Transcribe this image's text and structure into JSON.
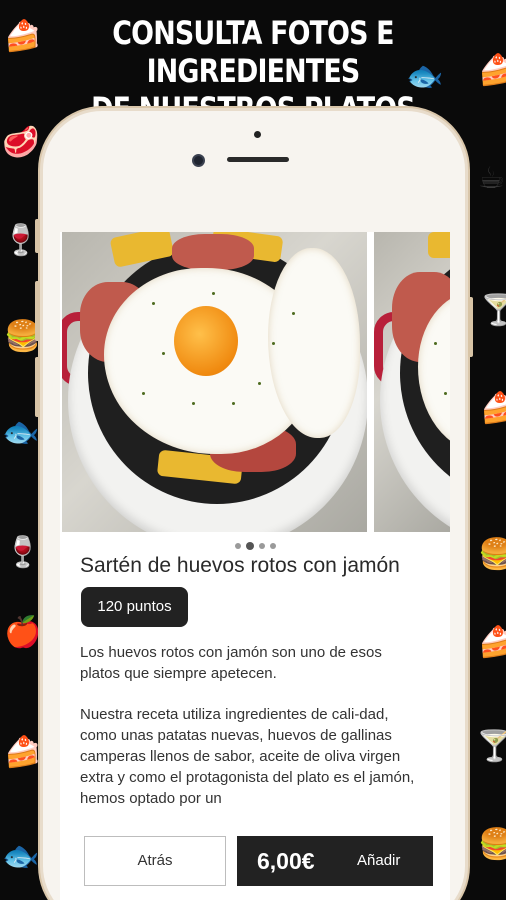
{
  "headline": {
    "line1": "CONSULTA FOTOS E INGREDIENTES",
    "line2": "DE NUESTROS PLATOS"
  },
  "product": {
    "name": "Sartén de huevos rotos con jamón",
    "points": "120 puntos",
    "description_p1": "Los huevos rotos con jamón son uno de esos platos que siempre apetecen.",
    "description_p2": "Nuestra receta utiliza ingredientes de cali-dad, como unas patatas nuevas, huevos de gallinas camperas llenos de sabor, aceite de oliva virgen extra y como el protagonista del plato es el jamón, hemos optado por un"
  },
  "carousel": {
    "total_slides": 4,
    "active_index": 1
  },
  "actions": {
    "back_label": "Atrás",
    "price": "6,00€",
    "add_label": "Añadir"
  },
  "background_icons": [
    "cake-icon",
    "fish-icon",
    "steak-icon",
    "wine-glass-icon",
    "martini-icon",
    "apple-icon",
    "burger-icon",
    "cocktail-icon",
    "cup-icon"
  ],
  "colors": {
    "background": "#0a0a0a",
    "phone_frame": "#f7f4ef",
    "dark_button": "#222222",
    "yolk": "#f08a10",
    "pan_handle": "#b8203a"
  }
}
